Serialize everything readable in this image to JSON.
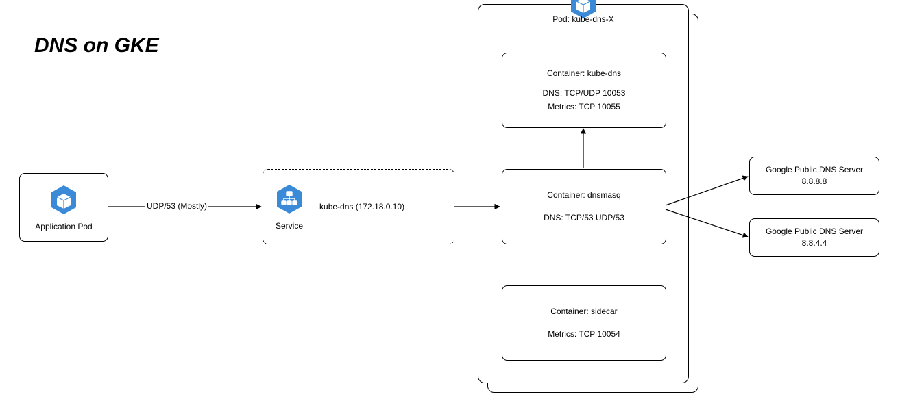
{
  "title": "DNS on GKE",
  "nodes": {
    "application_pod": {
      "label": "Application Pod"
    },
    "service": {
      "label": "Service",
      "detail": "kube-dns (172.18.0.10)"
    },
    "pod_group": {
      "label": "Pod: kube-dns-X"
    },
    "kube_dns": {
      "title": "Container: kube-dns",
      "line1": "DNS: TCP/UDP 10053",
      "line2": "Metrics: TCP 10055"
    },
    "dnsmasq": {
      "title": "Container: dnsmasq",
      "line1": "DNS: TCP/53 UDP/53"
    },
    "sidecar": {
      "title": "Container: sidecar",
      "line1": "Metrics: TCP 10054"
    },
    "dns1": {
      "title": "Google Public DNS Server",
      "ip": "8.8.8.8"
    },
    "dns2": {
      "title": "Google Public DNS Server",
      "ip": "8.8.4.4"
    }
  },
  "edges": {
    "app_to_service": "UDP/53 (Mostly)"
  },
  "colors": {
    "accent": "#3B8AD8"
  }
}
